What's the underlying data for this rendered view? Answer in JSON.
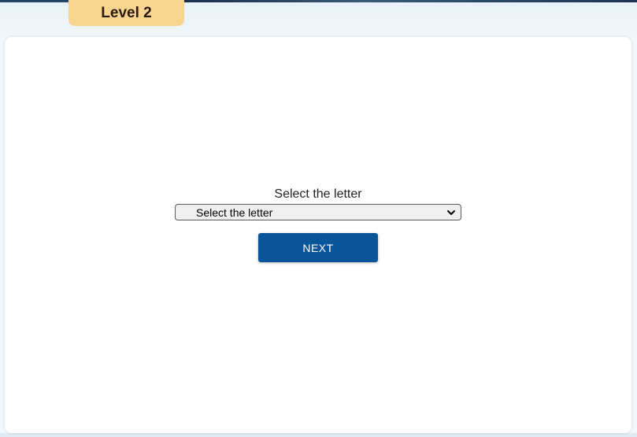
{
  "level_tab": {
    "label": "Level 2"
  },
  "form": {
    "prompt": "Select the letter",
    "select": {
      "selected_value": "Select the letter"
    },
    "next_button_label": "NEXT"
  },
  "icons": {
    "dropdown": "chevron-down-icon"
  },
  "colors": {
    "level_tab_bg": "#f7d58e",
    "next_button_bg": "#0a549a",
    "card_bg": "#ffffff",
    "page_bg": "#f2f8fb"
  }
}
